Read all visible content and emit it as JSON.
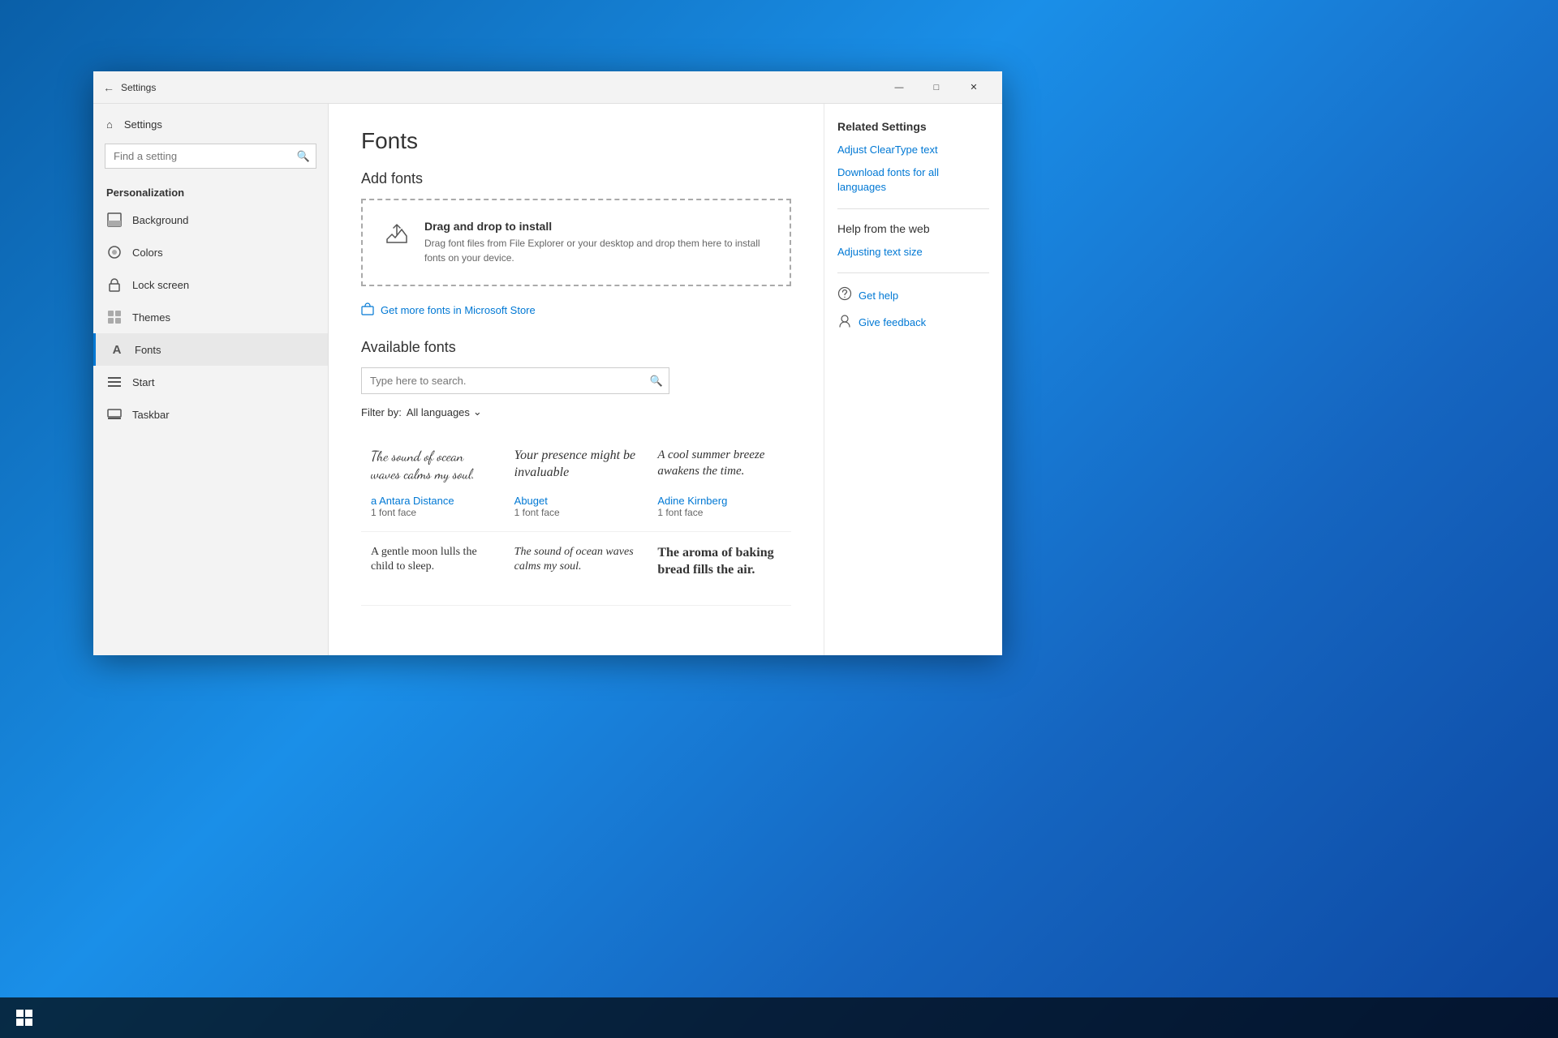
{
  "window": {
    "title": "Settings",
    "controls": {
      "minimize": "—",
      "maximize": "□",
      "close": "✕"
    }
  },
  "sidebar": {
    "back_label": "Settings",
    "search_placeholder": "Find a setting",
    "section_label": "Personalization",
    "items": [
      {
        "id": "background",
        "label": "Background",
        "icon": "🖼"
      },
      {
        "id": "colors",
        "label": "Colors",
        "icon": "🎨"
      },
      {
        "id": "lock-screen",
        "label": "Lock screen",
        "icon": "🔒"
      },
      {
        "id": "themes",
        "label": "Themes",
        "icon": "🎭"
      },
      {
        "id": "fonts",
        "label": "Fonts",
        "icon": "A",
        "active": true
      },
      {
        "id": "start",
        "label": "Start",
        "icon": "☰"
      },
      {
        "id": "taskbar",
        "label": "Taskbar",
        "icon": "▬"
      }
    ]
  },
  "main": {
    "page_title": "Fonts",
    "add_fonts_title": "Add fonts",
    "drop_zone": {
      "title": "Drag and drop to install",
      "description": "Drag font files from File Explorer or your desktop and drop them here to install fonts on your device."
    },
    "get_more_link": "Get more fonts in Microsoft Store",
    "available_fonts_title": "Available fonts",
    "search_placeholder": "Type here to search.",
    "filter_label": "Filter by:",
    "filter_value": "All languages",
    "fonts": [
      {
        "preview": "The sound of ocean waves calms my soul.",
        "style": "cursive-1",
        "name": "a Antara Distance",
        "faces": "1 font face"
      },
      {
        "preview": "Your presence might be invaluable",
        "style": "cursive-2",
        "name": "Abuget",
        "faces": "1 font face"
      },
      {
        "preview": "A cool summer breeze awakens the time.",
        "style": "cursive-3",
        "name": "Adine Kirnberg",
        "faces": "1 font face"
      },
      {
        "preview": "A gentle moon lulls the child to sleep.",
        "style": "script-1",
        "name": "",
        "faces": ""
      },
      {
        "preview": "The sound of ocean waves calms my soul.",
        "style": "script-2",
        "name": "",
        "faces": ""
      },
      {
        "preview": "The aroma of baking bread fills the air.",
        "style": "bold-serif",
        "name": "",
        "faces": ""
      }
    ]
  },
  "related": {
    "title": "Related Settings",
    "links": [
      "Adjust ClearType text",
      "Download fonts for all languages"
    ],
    "help_title": "Help from the web",
    "help_links": [
      "Adjusting text size"
    ],
    "actions": [
      {
        "icon": "❓",
        "label": "Get help"
      },
      {
        "icon": "👤",
        "label": "Give feedback"
      }
    ]
  },
  "taskbar": {
    "start_icon": "⊞"
  }
}
